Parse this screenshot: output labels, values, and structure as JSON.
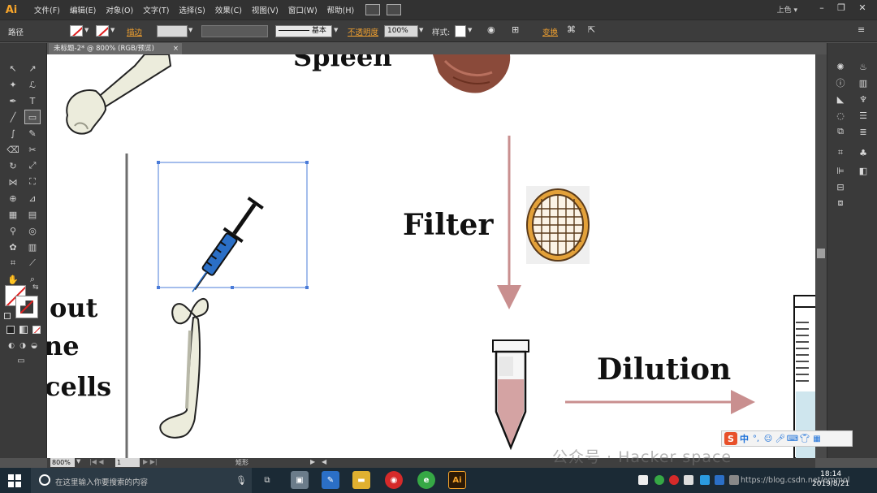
{
  "app": {
    "logo": "Ai",
    "menus": [
      "文件(F)",
      "编辑(E)",
      "对象(O)",
      "文字(T)",
      "选择(S)",
      "效果(C)",
      "视图(V)",
      "窗口(W)",
      "帮助(H)"
    ],
    "workspace": "上色",
    "window_controls": [
      "–",
      "❐",
      "✕"
    ]
  },
  "control_bar": {
    "selection_type": "路径",
    "stroke_label": "描边",
    "brush_label": "基本",
    "opacity_label": "不透明度",
    "opacity_value": "100%",
    "style_label": "样式",
    "recolor_label": "变换"
  },
  "document": {
    "tab_title": "未标题-2* @ 800% (RGB/预览)",
    "tab_close": "×"
  },
  "artwork": {
    "spleen_label": "Spleen",
    "filter_label": "Filter",
    "dilution_label": "Dilution",
    "left_text_1": "out",
    "left_text_2": "ne",
    "left_text_3": "cells"
  },
  "status_bar": {
    "zoom": "800%",
    "page": "1",
    "tool_status": "矩形"
  },
  "taskbar": {
    "search_placeholder": "在这里输入你要搜索的内容",
    "time": "18:14",
    "date": "2019/8/21"
  },
  "ime": {
    "brand": "S",
    "mode": "中"
  },
  "watermark": {
    "text": "公众号 · Hacker space",
    "url": "https://blog.csdn.net/emmol"
  },
  "colors": {
    "accent": "#f7a52b",
    "arrow": "#c98f8f",
    "syringe": "#2b6fc6",
    "tube_fill": "#d4a3a3",
    "filter_orange": "#e3a13a",
    "selection": "#4a7bd8"
  }
}
